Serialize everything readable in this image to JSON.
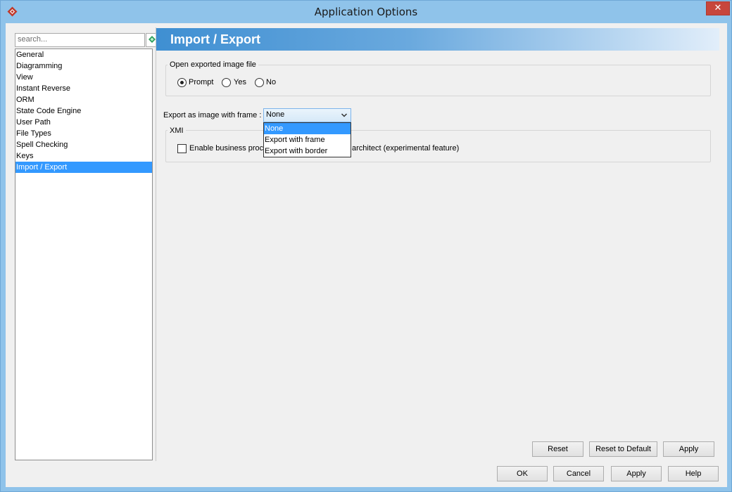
{
  "window": {
    "title": "Application Options",
    "close_glyph": "✕"
  },
  "sidebar": {
    "search_placeholder": "search...",
    "items": [
      {
        "label": "General"
      },
      {
        "label": "Diagramming"
      },
      {
        "label": "View"
      },
      {
        "label": "Instant Reverse"
      },
      {
        "label": "ORM"
      },
      {
        "label": "State Code Engine"
      },
      {
        "label": "User Path"
      },
      {
        "label": "File Types"
      },
      {
        "label": "Spell Checking"
      },
      {
        "label": "Keys"
      },
      {
        "label": "Import / Export",
        "selected": true
      }
    ]
  },
  "panel": {
    "title": "Import / Export",
    "open_image": {
      "legend": "Open exported image file",
      "options": [
        "Prompt",
        "Yes",
        "No"
      ],
      "selected": "Prompt"
    },
    "export_frame": {
      "label": "Export as image with frame :",
      "value": "None",
      "options": [
        "None",
        "Export with frame",
        "Export with border"
      ],
      "highlighted": "None"
    },
    "xmi": {
      "legend": "XMI",
      "checkbox_label_start": "Enable business proce",
      "checkbox_label_end": "architect (experimental feature)",
      "checked": false
    },
    "buttons": {
      "reset": "Reset",
      "reset_default": "Reset to Default",
      "apply": "Apply"
    }
  },
  "footer": {
    "ok": "OK",
    "cancel": "Cancel",
    "apply": "Apply",
    "help": "Help"
  },
  "colors": {
    "titlebar": "#8fc3ea",
    "selection": "#3399ff",
    "close": "#c7463c",
    "header_start": "#3f8fd2"
  }
}
